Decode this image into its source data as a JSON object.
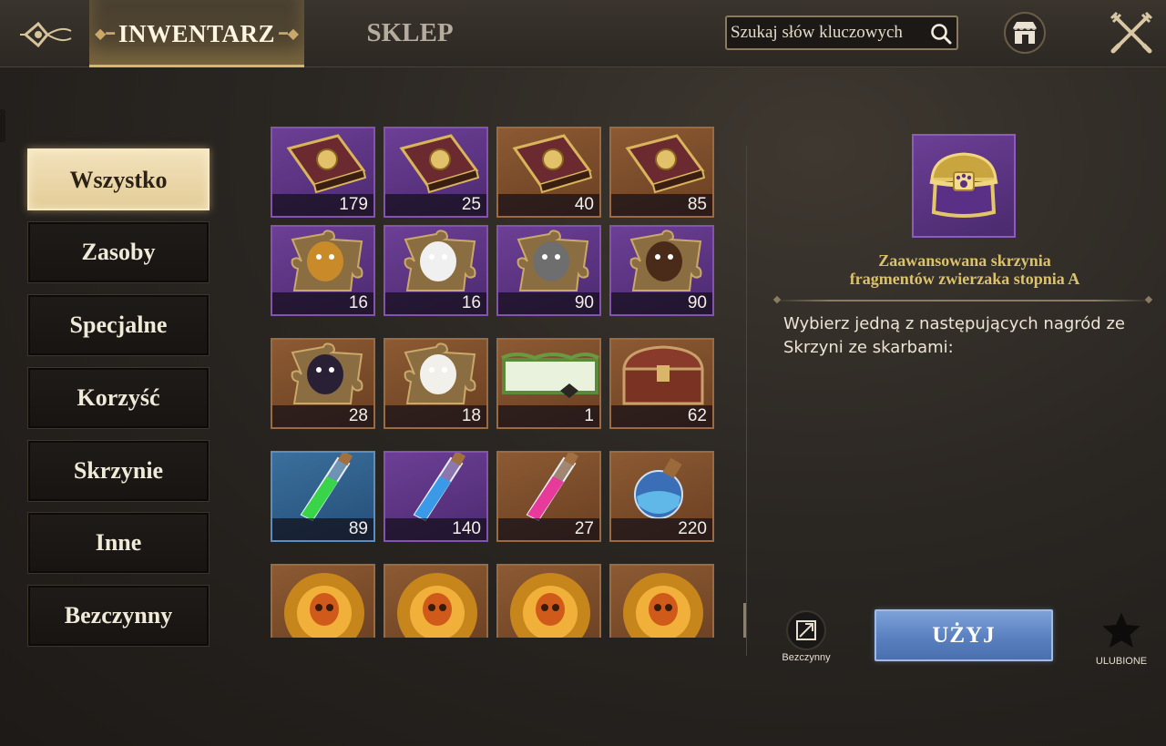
{
  "header": {
    "tabs": [
      {
        "label": "INWENTARZ",
        "active": true
      },
      {
        "label": "SKLEP",
        "active": false
      }
    ],
    "search": {
      "placeholder": "Szukaj słów kluczowych",
      "value": ""
    },
    "icons": {
      "back": "ornament-back-icon",
      "shop": "shop-icon",
      "close": "crossed-swords-close-icon"
    }
  },
  "sidebar": {
    "items": [
      {
        "label": "Wszystko",
        "active": true
      },
      {
        "label": "Zasoby",
        "active": false
      },
      {
        "label": "Specjalne",
        "active": false
      },
      {
        "label": "Korzyść",
        "active": false
      },
      {
        "label": "Skrzynie",
        "active": false
      },
      {
        "label": "Inne",
        "active": false
      },
      {
        "label": "Bezczynny",
        "active": false
      }
    ]
  },
  "inventory": {
    "items": [
      {
        "icon": "owl-book-icon",
        "rarity": "purple",
        "count": "179"
      },
      {
        "icon": "rabbit-book-icon",
        "rarity": "purple",
        "count": "25"
      },
      {
        "icon": "wolf-book-icon",
        "rarity": "orange",
        "count": "40"
      },
      {
        "icon": "cat-book-icon",
        "rarity": "orange",
        "count": "85"
      },
      {
        "icon": "wizard-cat-puzzle-icon",
        "rarity": "purple",
        "count": "16"
      },
      {
        "icon": "white-rabbit-puzzle-icon",
        "rarity": "purple",
        "count": "16"
      },
      {
        "icon": "wolf-puzzle-icon",
        "rarity": "purple",
        "count": "90"
      },
      {
        "icon": "dachshund-puzzle-icon",
        "rarity": "purple",
        "count": "90"
      },
      {
        "icon": "black-cat-puzzle-icon",
        "rarity": "orange",
        "count": "28"
      },
      {
        "icon": "panda-puzzle-icon",
        "rarity": "orange",
        "count": "18"
      },
      {
        "icon": "scroll-banner-icon",
        "rarity": "orange",
        "count": "1"
      },
      {
        "icon": "treasure-chest-icon",
        "rarity": "orange",
        "count": "62"
      },
      {
        "icon": "green-potion-tube-icon",
        "rarity": "blue",
        "count": "89"
      },
      {
        "icon": "blue-potion-tube-icon",
        "rarity": "purple",
        "count": "140"
      },
      {
        "icon": "pink-potion-tube-icon",
        "rarity": "orange",
        "count": "27"
      },
      {
        "icon": "blue-potion-flask-icon",
        "rarity": "orange",
        "count": "220"
      },
      {
        "icon": "golden-skull-chest-icon",
        "rarity": "orange",
        "count": ""
      },
      {
        "icon": "golden-skull-emblem-icon",
        "rarity": "orange",
        "count": ""
      },
      {
        "icon": "golden-skull-emblem-icon",
        "rarity": "orange",
        "count": ""
      },
      {
        "icon": "golden-skull-chest-icon",
        "rarity": "orange",
        "count": ""
      }
    ]
  },
  "detail": {
    "icon": "pet-fragment-chest-icon",
    "title_line1": "Zaawansowana skrzynia",
    "title_line2": "fragmentów zwierzaka stopnia A",
    "description": "Wybierz jedną z następujących nagród ze Skrzyni ze skarbami:",
    "idle_label": "Bezczynny",
    "use_label": "UŻYJ",
    "favorite_label": "ULUBIONE"
  },
  "colors": {
    "accent_gold": "#dcc36a",
    "active_tab_text": "#2c2115",
    "use_button": "#5a80c0",
    "rarity_purple": "#6c3f95",
    "rarity_orange": "#8c5a33",
    "rarity_blue": "#3b6f9c"
  }
}
